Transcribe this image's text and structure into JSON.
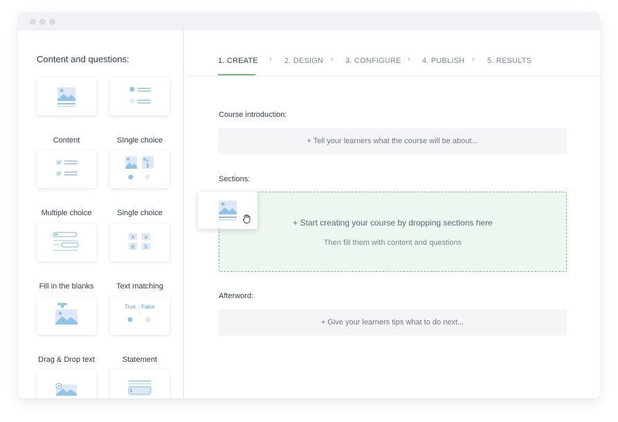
{
  "sidebar": {
    "title": "Content and questions:",
    "items": [
      {
        "label": "Content",
        "icon": "image-content-icon"
      },
      {
        "label": "SIngle choice",
        "icon": "single-choice-icon"
      },
      {
        "label": "Multiple choice",
        "icon": "multiple-choice-icon"
      },
      {
        "label": "Single choice",
        "icon": "image-single-choice-icon"
      },
      {
        "label": "Fill in the blanks",
        "icon": "fill-blanks-icon"
      },
      {
        "label": "Text matching",
        "icon": "text-matching-icon"
      },
      {
        "label": "Drag & Drop text",
        "icon": "drag-drop-icon"
      },
      {
        "label": "Statement",
        "icon": "statement-icon"
      },
      {
        "label": "",
        "icon": "hotspot-icon"
      },
      {
        "label": "",
        "icon": "open-question-icon"
      }
    ],
    "matching_letters": [
      "A",
      "a",
      "B",
      "b"
    ],
    "statement_true": "True",
    "statement_false": "False"
  },
  "steps": [
    {
      "label": "1. CREATE"
    },
    {
      "label": "2. DESIGN"
    },
    {
      "label": "3. CONFIGURE"
    },
    {
      "label": "4. PUBLISH"
    },
    {
      "label": "5. RESULTS"
    }
  ],
  "main": {
    "intro_label": "Course introduction:",
    "intro_placeholder": "+ Tell your learners what the course will be about...",
    "sections_label": "Sections:",
    "dropzone_title": "+ Start creating your course by dropping sections here",
    "dropzone_subtitle": "Then fill them with content and questions",
    "afterword_label": "Afterword:",
    "afterword_placeholder": "+ Give your learners tips what to do next..."
  },
  "colors": {
    "accent_green": "#69c373",
    "icon_blue": "#8fc4e8",
    "icon_light": "#dde9f4"
  }
}
